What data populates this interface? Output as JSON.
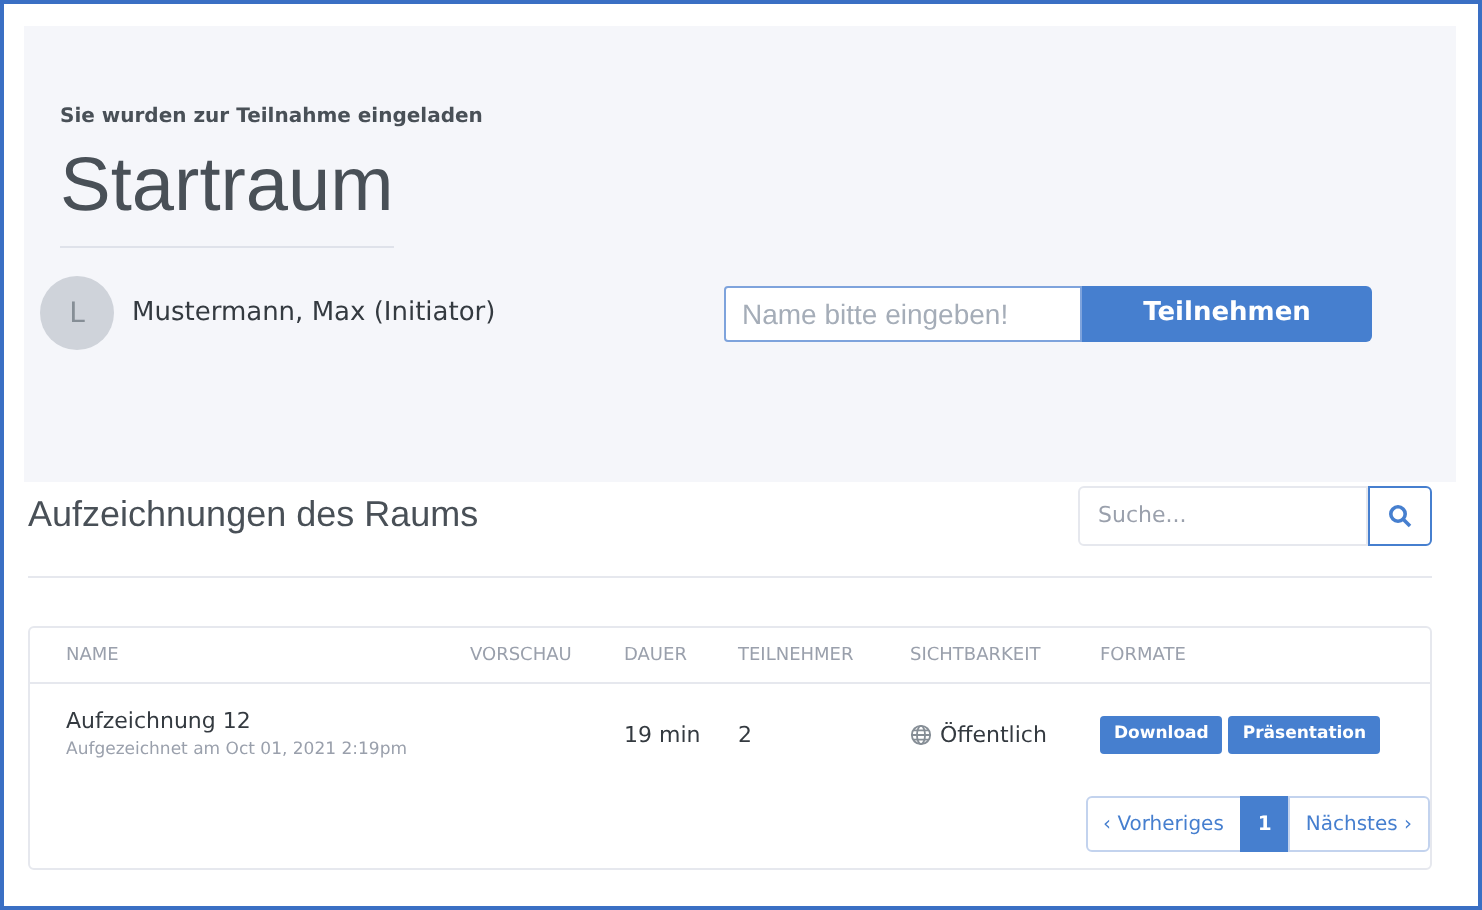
{
  "invite": {
    "subtitle": "Sie wurden zur Teilnahme eingeladen",
    "title": "Startraum",
    "owner_initial": "L",
    "owner": "Mustermann, Max (Initiator)",
    "name_field": {
      "placeholder": "Name bitte eingeben!"
    },
    "join_button": "Teilnehmen"
  },
  "recordings": {
    "title": "Aufzeichnungen des Raums",
    "search": {
      "placeholder": "Suche..."
    },
    "columns": [
      "NAME",
      "VORSCHAU",
      "DAUER",
      "TEILNEHMER",
      "SICHTBARKEIT",
      "FORMATE"
    ],
    "rows": [
      {
        "name": "Aufzeichnung 12",
        "recorded": "Aufgezeichnet am Oct 01, 2021 2:19pm",
        "duration": "19 min",
        "participants": "2",
        "visibility": "Öffentlich",
        "formats": [
          "Download",
          "Präsentation"
        ]
      }
    ],
    "pagination": {
      "previous": "‹ Vorheriges",
      "pages": [
        {
          "label": "1",
          "selected": true
        }
      ],
      "next": "Nächstes ›"
    }
  }
}
